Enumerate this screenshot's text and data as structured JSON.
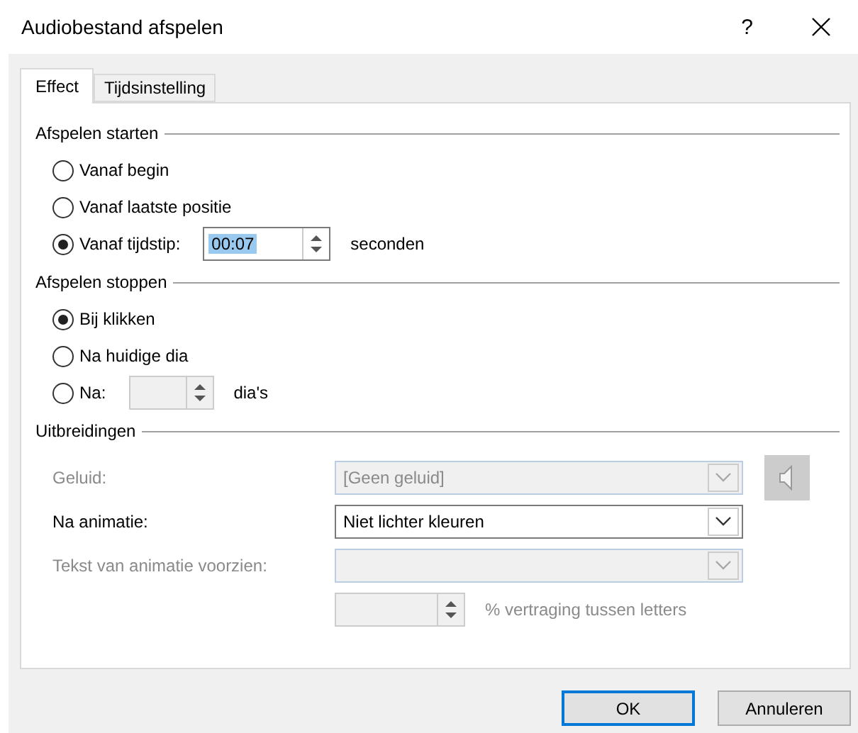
{
  "window": {
    "title": "Audiobestand afspelen",
    "help": "?"
  },
  "tabs": [
    {
      "label": "Effect",
      "selected": true
    },
    {
      "label": "Tijdsinstelling",
      "selected": false
    }
  ],
  "start": {
    "title": "Afspelen starten",
    "options": [
      {
        "kind": "plain",
        "label": "Vanaf begin",
        "selected": false
      },
      {
        "kind": "plain",
        "label": "Vanaf laatste positie",
        "selected": false
      },
      {
        "kind": "spinner",
        "label": "Vanaf tijdstip:",
        "selected": true,
        "value": "00:07",
        "text_selected": true,
        "disabled": false,
        "suffix": "seconden"
      }
    ]
  },
  "stop": {
    "title": "Afspelen stoppen",
    "options": [
      {
        "kind": "plain",
        "label": "Bij klikken",
        "selected": true
      },
      {
        "kind": "plain",
        "label": "Na huidige dia",
        "selected": false
      },
      {
        "kind": "spinner",
        "label": "Na:",
        "selected": false,
        "disabled": true,
        "suffix": "dia's"
      }
    ]
  },
  "extensions": {
    "title": "Uitbreidingen",
    "rows": [
      {
        "kind": "combo",
        "label": "Geluid:",
        "value": "[Geen geluid]",
        "disabled": true,
        "sound_button": true
      },
      {
        "kind": "combo",
        "label": "Na animatie:",
        "value": "Niet lichter kleuren",
        "disabled": false
      },
      {
        "kind": "combo",
        "label": "Tekst van animatie voorzien:",
        "disabled": true
      },
      {
        "kind": "spinner",
        "suffix": "% vertraging tussen letters",
        "disabled": true
      }
    ]
  },
  "buttons": [
    {
      "label": "OK",
      "default": true
    },
    {
      "label": "Annuleren",
      "default": false
    }
  ]
}
